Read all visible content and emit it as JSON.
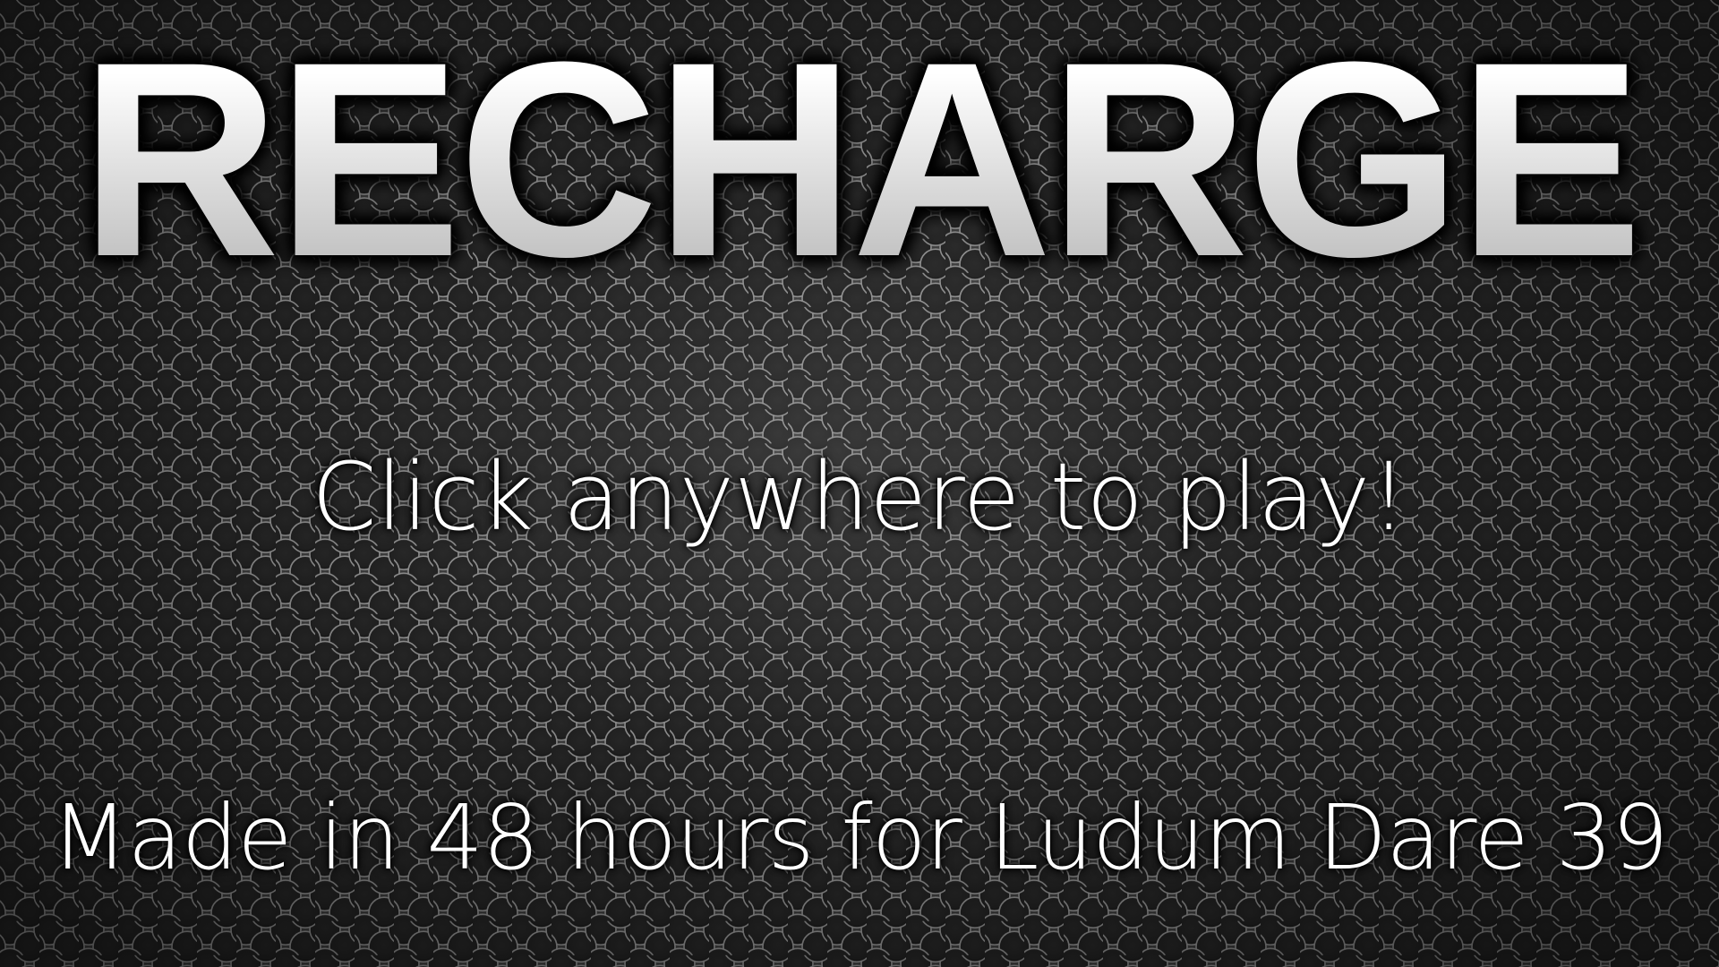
{
  "game": {
    "title": "RECHARGE",
    "prompt": "Click anywhere to play!",
    "credit": "Made in 48 hours for Ludum Dare 39"
  },
  "background": {
    "texture": "hexagonal-metal-grille",
    "base_color": "#2b2b2b",
    "hole_color": "#232323",
    "rim_color": "#9a9a9a"
  }
}
